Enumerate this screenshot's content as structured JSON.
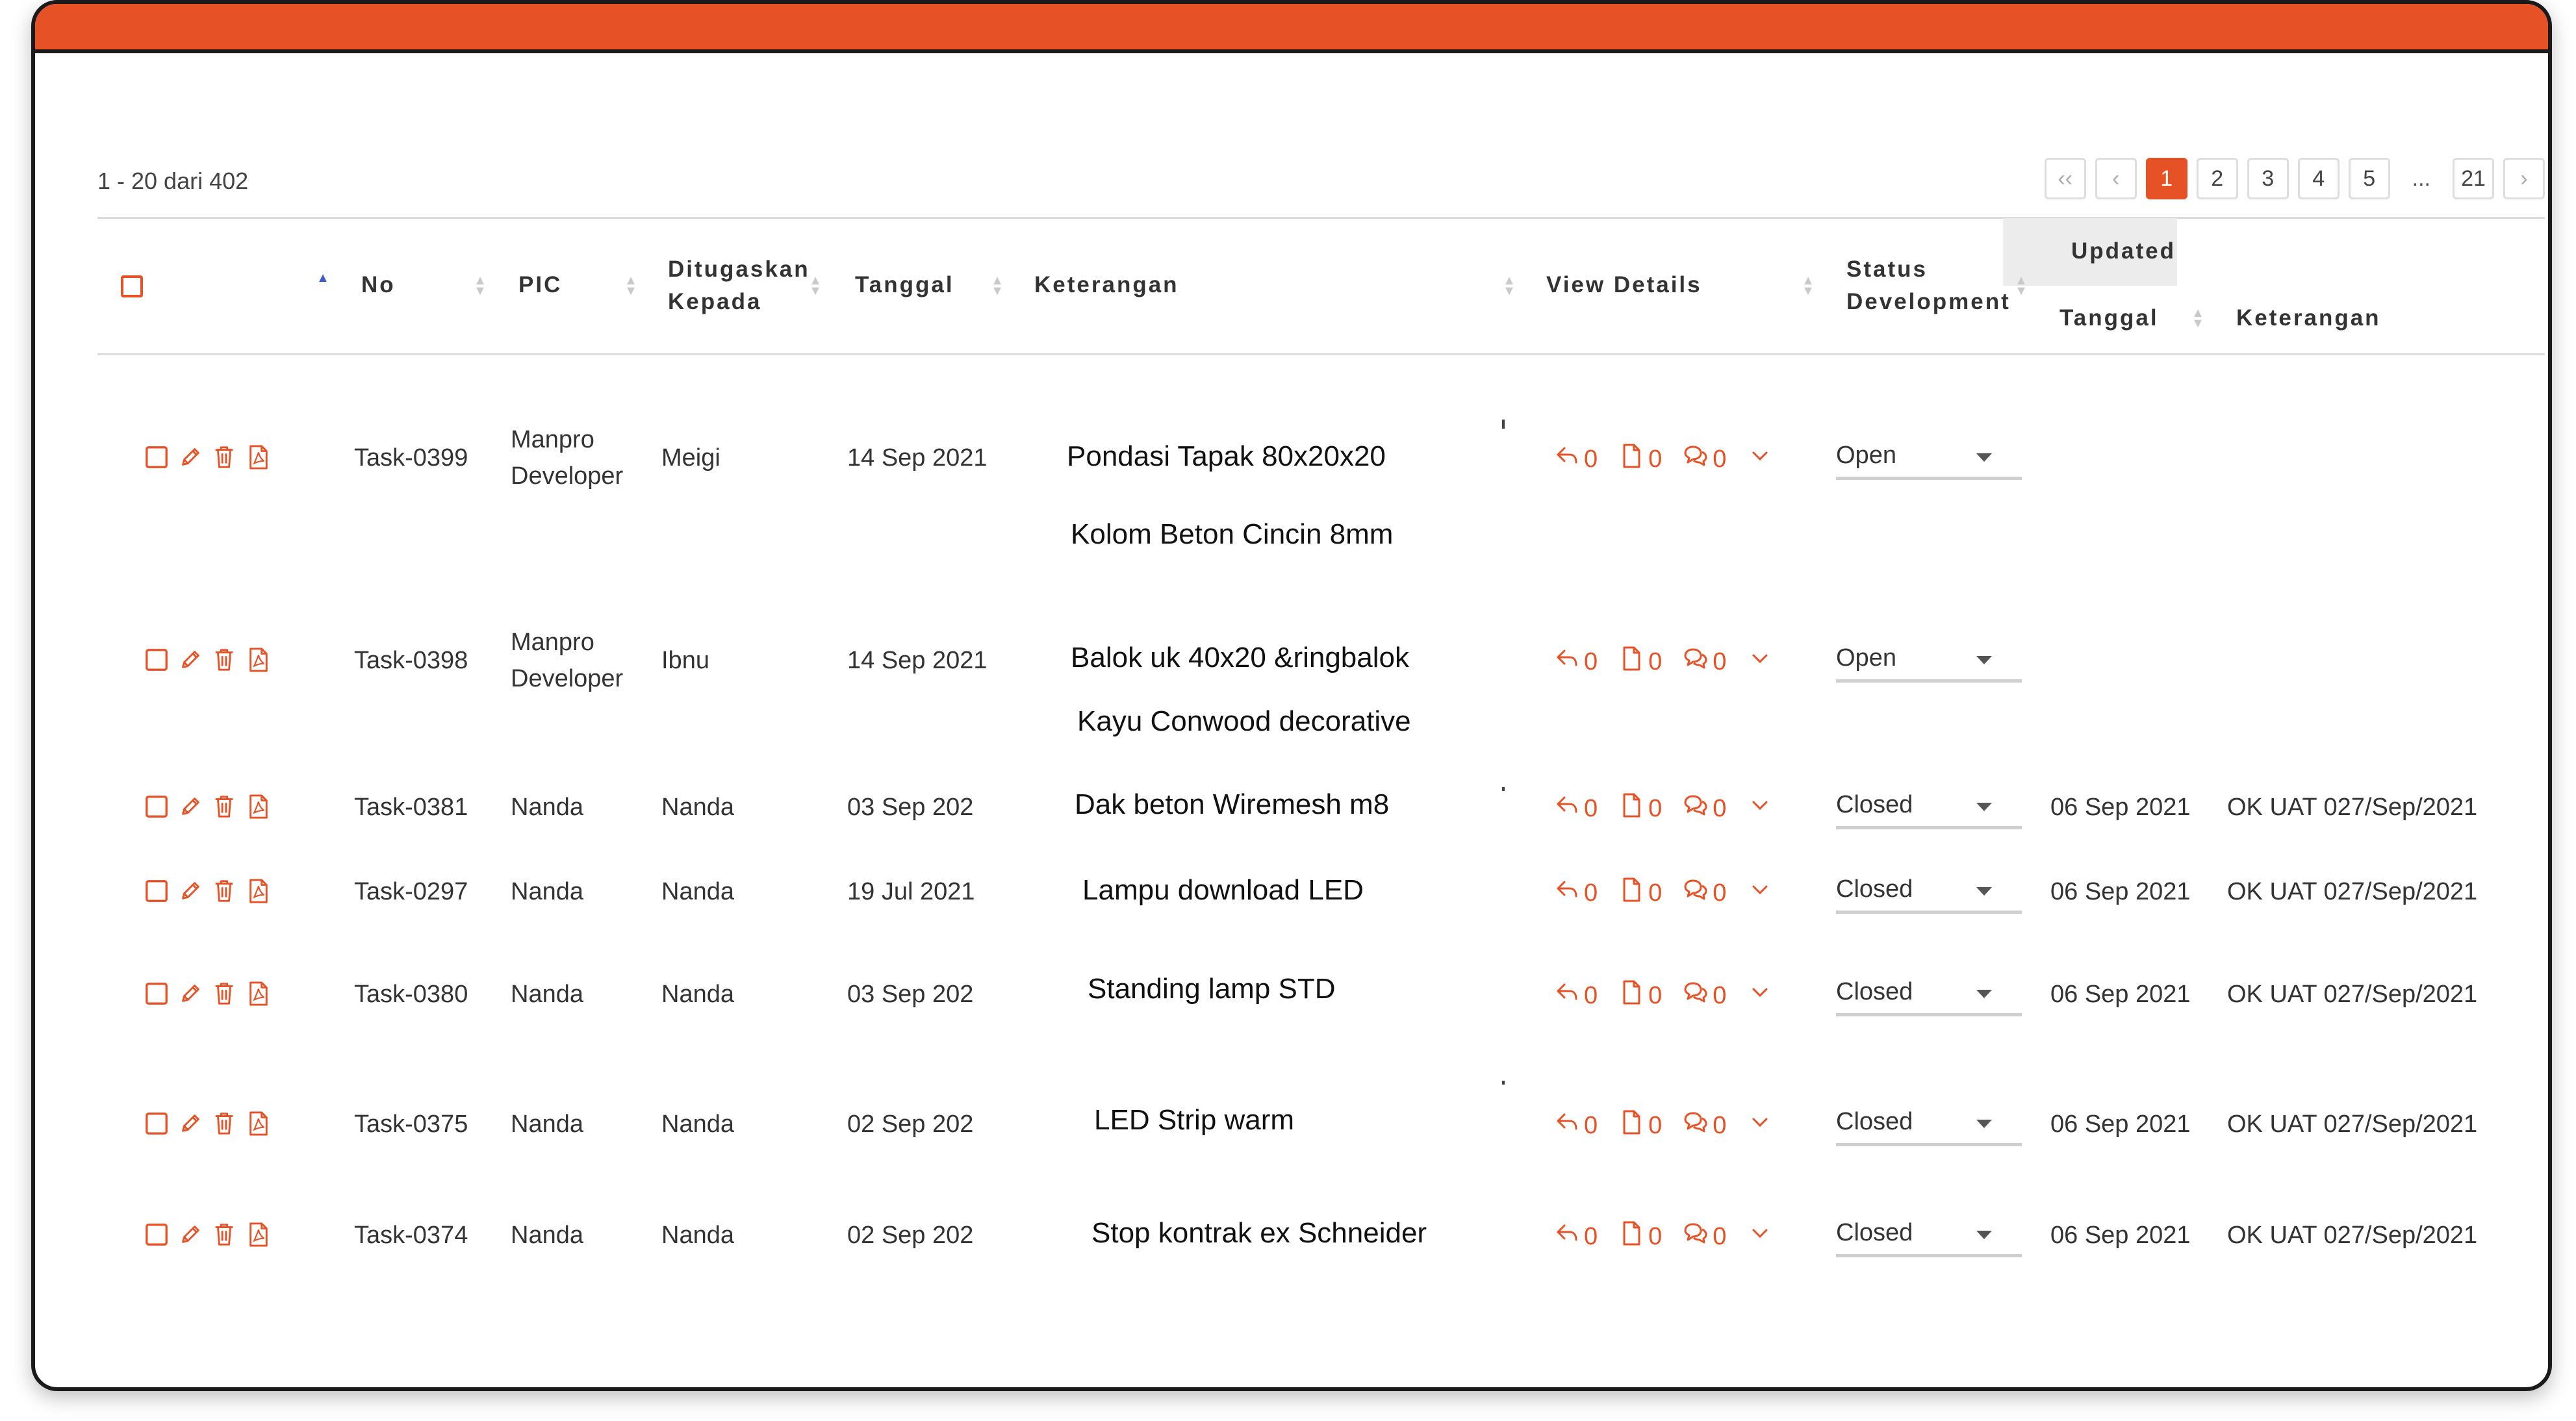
{
  "accent": "#e75126",
  "summary": "1 - 20 dari 402",
  "pagination": {
    "first": "‹‹",
    "prev": "‹",
    "pages": [
      "1",
      "2",
      "3",
      "4",
      "5"
    ],
    "active": "1",
    "ellipsis": "...",
    "last": "21",
    "next": "›"
  },
  "columns": {
    "no": "No",
    "pic": "PIC",
    "assigned_1": "Ditugaskan",
    "assigned_2": "Kepada",
    "date": "Tanggal",
    "desc": "Keterangan",
    "view": "View Details",
    "status_1": "Status",
    "status_2": "Development",
    "updated": "Updated",
    "upd_date": "Tanggal",
    "upd_desc": "Keterangan"
  },
  "rows": [
    {
      "no": "Task-0399",
      "pic_1": "Manpro",
      "pic_2": "Developer",
      "assigned": "Meigi",
      "date": "14 Sep 2021",
      "desc_1": "Pondasi Tapak 80x20x20",
      "desc_2": "Kolom Beton Cincin 8mm",
      "replies": "0",
      "files": "0",
      "comments": "0",
      "status": "Open",
      "upd_date": "",
      "upd_desc": ""
    },
    {
      "no": "Task-0398",
      "pic_1": "Manpro",
      "pic_2": "Developer",
      "assigned": "Ibnu",
      "date": "14 Sep 2021",
      "desc_1": "Balok uk 40x20 &ringbalok",
      "desc_2": "Kayu Conwood decorative",
      "replies": "0",
      "files": "0",
      "comments": "0",
      "status": "Open",
      "upd_date": "",
      "upd_desc": ""
    },
    {
      "no": "Task-0381",
      "pic_1": "Nanda",
      "pic_2": "",
      "assigned": "Nanda",
      "date": "03 Sep 202",
      "desc_1": "Dak beton Wiremesh m8",
      "desc_2": "",
      "replies": "0",
      "files": "0",
      "comments": "0",
      "status": "Closed",
      "upd_date": "06 Sep 2021",
      "upd_desc": "OK UAT 027/Sep/2021"
    },
    {
      "no": "Task-0297",
      "pic_1": "Nanda",
      "pic_2": "",
      "assigned": "Nanda",
      "date": "19 Jul 2021",
      "desc_1": "Lampu download LED",
      "desc_2": "",
      "replies": "0",
      "files": "0",
      "comments": "0",
      "status": "Closed",
      "upd_date": "06 Sep 2021",
      "upd_desc": "OK UAT 027/Sep/2021"
    },
    {
      "no": "Task-0380",
      "pic_1": "Nanda",
      "pic_2": "",
      "assigned": "Nanda",
      "date": "03 Sep 202",
      "desc_1": "Standing lamp STD",
      "desc_2": "",
      "replies": "0",
      "files": "0",
      "comments": "0",
      "status": "Closed",
      "upd_date": "06 Sep 2021",
      "upd_desc": "OK UAT 027/Sep/2021"
    },
    {
      "no": "Task-0375",
      "pic_1": "Nanda",
      "pic_2": "",
      "assigned": "Nanda",
      "date": "02 Sep 202",
      "desc_1": "LED Strip warm",
      "desc_2": "",
      "replies": "0",
      "files": "0",
      "comments": "0",
      "status": "Closed",
      "upd_date": "06 Sep 2021",
      "upd_desc": "OK UAT 027/Sep/2021"
    },
    {
      "no": "Task-0374",
      "pic_1": "Nanda",
      "pic_2": "",
      "assigned": "Nanda",
      "date": "02 Sep 202",
      "desc_1": "Stop kontrak ex Schneider",
      "desc_2": "",
      "replies": "0",
      "files": "0",
      "comments": "0",
      "status": "Closed",
      "upd_date": "06 Sep 2021",
      "upd_desc": "OK UAT 027/Sep/2021"
    }
  ]
}
